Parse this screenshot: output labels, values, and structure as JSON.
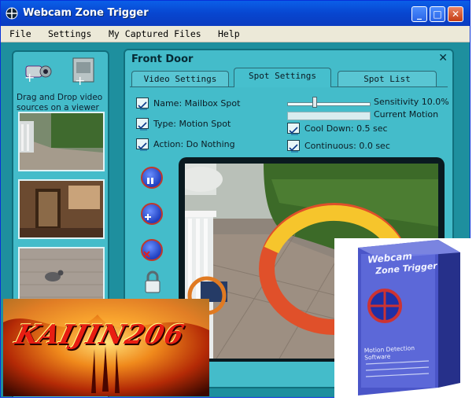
{
  "window": {
    "title": "Webcam Zone Trigger",
    "min": "_",
    "max": "□",
    "close": "✕"
  },
  "menu": [
    "File",
    "Settings",
    "My Captured Files",
    "Help"
  ],
  "left_panel": {
    "drag_text": "Drag and Drop video sources on a viewer"
  },
  "viewer": {
    "title": "Front Door",
    "close": "✕",
    "tabs": [
      "Video Settings",
      "Spot Settings",
      "Spot List"
    ],
    "active_tab": "Spot Settings",
    "options_left": [
      "Name: Mailbox Spot",
      "Type: Motion Spot",
      "Action: Do Nothing"
    ],
    "sensitivity_label": "Sensitivity 10.0%",
    "sensitivity": 0.1,
    "current_motion_label": "Current Motion",
    "cooldown_label": "Cool Down: 0.5 sec",
    "continuous_label": "Continuous: 0.0 sec"
  },
  "overlay": {
    "banner_text": "KAIJIN206"
  },
  "box_art": {
    "title_line1": "Webcam",
    "title_line2": "Zone Trigger",
    "tagline": "Motion Detection Software"
  },
  "colors": {
    "teal": "#1e8f9e",
    "panel": "#44bcca",
    "titlebar": "#0846d0"
  }
}
